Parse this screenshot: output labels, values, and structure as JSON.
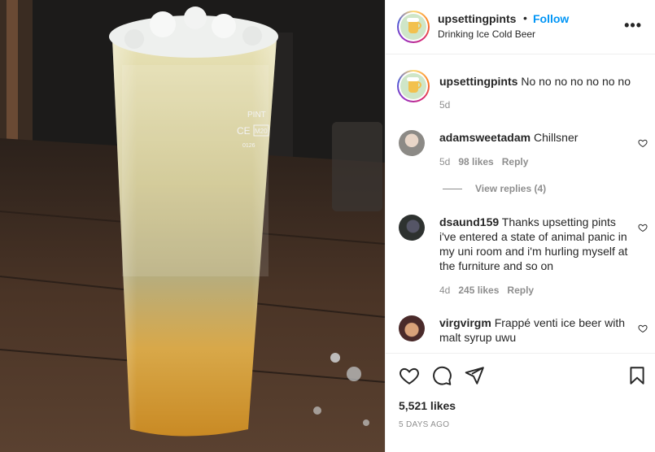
{
  "post": {
    "author": "upsettingpints",
    "follow_label": "Follow",
    "separator": "•",
    "location": "Drinking Ice Cold Beer",
    "more_label": "•••",
    "likes": "5,521 likes",
    "date": "5 DAYS AGO",
    "photo_text": {
      "pint": "PINT",
      "ce": "CE",
      "mark": "M20",
      "code": "0126"
    }
  },
  "caption": {
    "user": "upsettingpints",
    "text": "No no no no no no no",
    "time": "5d"
  },
  "comments": [
    {
      "user": "adamsweetadam",
      "text": "Chillsner",
      "time": "5d",
      "likes": "98 likes",
      "reply": "Reply",
      "view_replies": "View replies (4)"
    },
    {
      "user": "dsaund159",
      "text": "Thanks upsetting pints i've entered a state of animal panic in my uni room and i'm hurling myself at the furniture and so on",
      "time": "4d",
      "likes": "245 likes",
      "reply": "Reply"
    },
    {
      "user": "virgvirgm",
      "text": "Frappé venti ice beer with malt syrup uwu"
    }
  ],
  "icons": {
    "like": "heart-icon",
    "comment": "comment-bubble-icon",
    "share": "paper-plane-icon",
    "save": "bookmark-icon",
    "more": "more-options-icon",
    "comment_like": "heart-icon"
  },
  "colors": {
    "accent": "#0095f6",
    "text": "#262626",
    "muted": "#8e8e8e",
    "border": "#efefef"
  }
}
